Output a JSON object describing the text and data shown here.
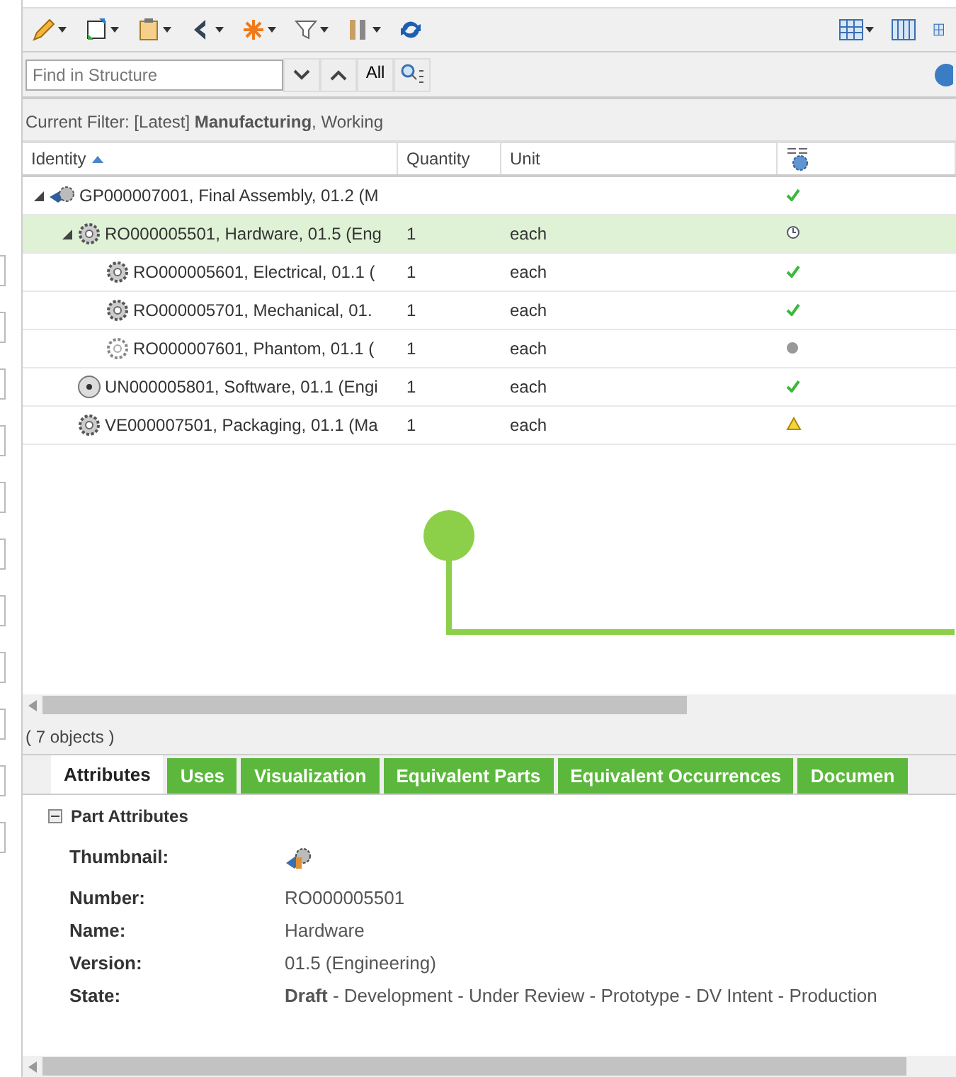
{
  "search": {
    "placeholder": "Find in Structure",
    "all_label": "All"
  },
  "filter": "Current Filter: [Latest] **Manufacturing**, Working",
  "table": {
    "columns": [
      "Identity",
      "Quantity",
      "Unit"
    ],
    "rows": [
      {
        "identity": "GP000007001, Final Assembly, 01.2 (M",
        "icon": {
          "kind": "assembly"
        },
        "quantity": "",
        "unit": "",
        "status": {
          "kind": "check"
        },
        "selected": false,
        "expanded": true,
        "children": [
          {
            "identity": "RO000005501, Hardware, 01.5 (Eng",
            "icon": {
              "kind": "part"
            },
            "quantity": "1",
            "unit": "each",
            "status": {
              "kind": "clock"
            },
            "selected": true,
            "expanded": true,
            "children": [
              {
                "identity": "RO000005601, Electrical, 01.1 (",
                "icon": {
                  "kind": "part"
                },
                "quantity": "1",
                "unit": "each",
                "status": {
                  "kind": "check"
                },
                "selected": false
              },
              {
                "identity": "RO000005701, Mechanical, 01.",
                "icon": {
                  "kind": "part"
                },
                "quantity": "1",
                "unit": "each",
                "status": {
                  "kind": "check"
                },
                "selected": false
              },
              {
                "identity": "RO000007601, Phantom, 01.1 (",
                "icon": {
                  "kind": "phantom"
                },
                "quantity": "1",
                "unit": "each",
                "status": {
                  "kind": "dot"
                },
                "selected": false
              }
            ]
          },
          {
            "identity": "UN000005801, Software, 01.1 (Engi",
            "icon": {
              "kind": "software"
            },
            "quantity": "1",
            "unit": "each",
            "status": {
              "kind": "check"
            },
            "selected": false
          },
          {
            "identity": "VE000007501, Packaging, 01.1 (Ma",
            "icon": {
              "kind": "part"
            },
            "quantity": "1",
            "unit": "each",
            "status": {
              "kind": "warning"
            },
            "selected": false
          }
        ]
      }
    ]
  },
  "count": "( 7 objects )",
  "tabs": [
    {
      "label": "Attributes",
      "selected": true
    },
    {
      "label": "Uses",
      "selected": false
    },
    {
      "label": "Visualization",
      "selected": false
    },
    {
      "label": "Equivalent Parts",
      "selected": false
    },
    {
      "label": "Equivalent Occurrences",
      "selected": false
    },
    {
      "label": "Documen",
      "selected": false
    }
  ],
  "attributes": {
    "title": "Part Attributes",
    "expanded": true,
    "fields": [
      {
        "label": "Thumbnail:",
        "kind": "thumbnail"
      },
      {
        "label": "Number:",
        "kind": "text",
        "value": "RO000005501"
      },
      {
        "label": "Name:",
        "kind": "text",
        "value": "Hardware"
      },
      {
        "label": "Version:",
        "kind": "text",
        "value": "01.5 (Engineering)"
      },
      {
        "label": "State:",
        "kind": "text",
        "value": "**Draft** - Development - Under Review - Prototype - DV Intent - Production"
      }
    ]
  }
}
